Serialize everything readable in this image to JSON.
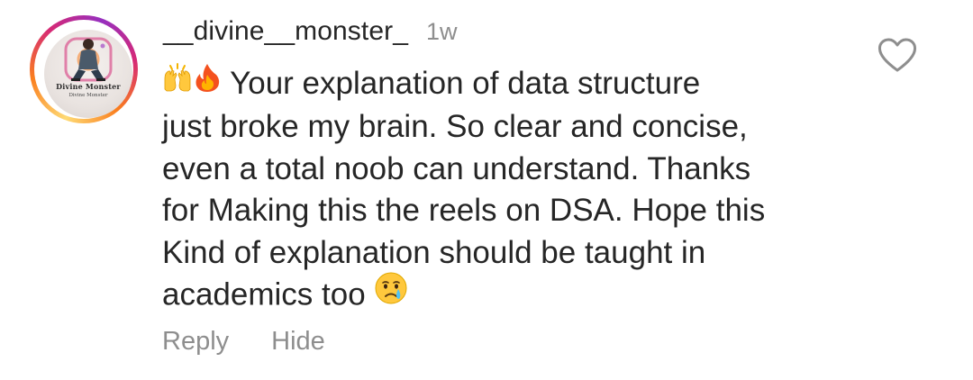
{
  "comment": {
    "avatar": {
      "name_line": "Divine Monster",
      "sub_line": "Divine Monster"
    },
    "username": "__divine__monster_",
    "timestamp": "1w",
    "text": {
      "emojis_leading": [
        "raising-hands-emoji",
        "fire-emoji"
      ],
      "lines": [
        "Your explanation of data structure",
        "just broke my brain. So clear and concise,",
        "even a total noob can understand. Thanks",
        "for Making this the reels on DSA. Hope this",
        "Kind of explanation should be taught in",
        "academics too"
      ],
      "emoji_trailing": "crying-face-emoji"
    },
    "actions": {
      "reply_label": "Reply",
      "hide_label": "Hide"
    },
    "like_icon": "heart-outline-icon",
    "colors": {
      "primary_text": "#262626",
      "secondary_text": "#8e8e8e",
      "story_ring": [
        "#feda75",
        "#fa7e1e",
        "#d62976",
        "#962fbf"
      ]
    }
  }
}
